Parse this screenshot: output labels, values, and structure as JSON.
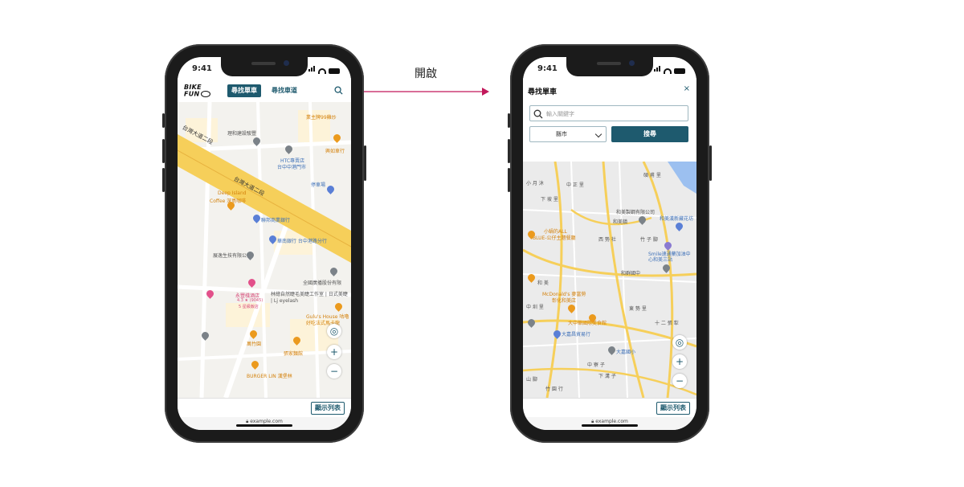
{
  "annotation": {
    "label": "開啟"
  },
  "status_bar": {
    "time": "9:41"
  },
  "left_screen": {
    "logo_line1": "BIKE",
    "logo_line2": "FUN",
    "tabs": [
      {
        "label": "尋找單車",
        "active": true
      },
      {
        "label": "尋找車道",
        "active": false
      }
    ],
    "map_labels": [
      "業主牌99雞炒",
      "台灣大道二段",
      "理和建設駿豐",
      "興如車行",
      "HTC專賣店",
      "台中中港門市",
      "停車場",
      "台灣大道二段",
      "Deep Island",
      "Coffee 深島咖啡",
      "聯邦商業銀行",
      "華南銀行 台中港路分行",
      "展逸生技有限公司",
      "全國廣播股份有限",
      "永豐棧酒店",
      "林總自然睫毛美睫工作室 | 日式美睫 | Lj eyelash",
      "Gulu's House 咕嚕",
      "好吃法式馬卡龍",
      "萬竹園",
      "張家麵館",
      "BURGER LIN 漢堡林"
    ],
    "hotel_rating": "4.3 ★ (9045)",
    "hotel_tag": "5 星級飯店",
    "list_button": "顯示列表",
    "url": "example.com"
  },
  "right_screen": {
    "title": "尋找單車",
    "close": "×",
    "keyword_placeholder": "輸入關鍵字",
    "city_select": "縣市",
    "search_button": "搜尋",
    "map_labels": [
      "小 月 沐",
      "中 正 里",
      "碩 甫 里",
      "下 坡 里",
      "和美製鋼有限公司",
      "和美鎮",
      "和美漢新藏花坊",
      "小蝸的ALL",
      "BLUE-公仔主題餐廳",
      "西 勢 社",
      "竹 子 腳",
      "Smile速通藥加油中心和美三站",
      "和 美",
      "和群國中",
      "McDonald's 麥當勞",
      "彰化和美店",
      "大中華國際美食館",
      "大嘉昌貿易行",
      "大嘉國小",
      "竹 園 行",
      "中 寮 子",
      "下 溝 子",
      "十 二 張 犁",
      "山 腳",
      "東 勢 里",
      "中 圳 里"
    ],
    "list_button": "顯示列表",
    "url": "example.com"
  },
  "colors": {
    "brand": "#1e5a6e",
    "road_yellow": "#f6cf5a",
    "poi_orange": "#eb9a1d"
  }
}
